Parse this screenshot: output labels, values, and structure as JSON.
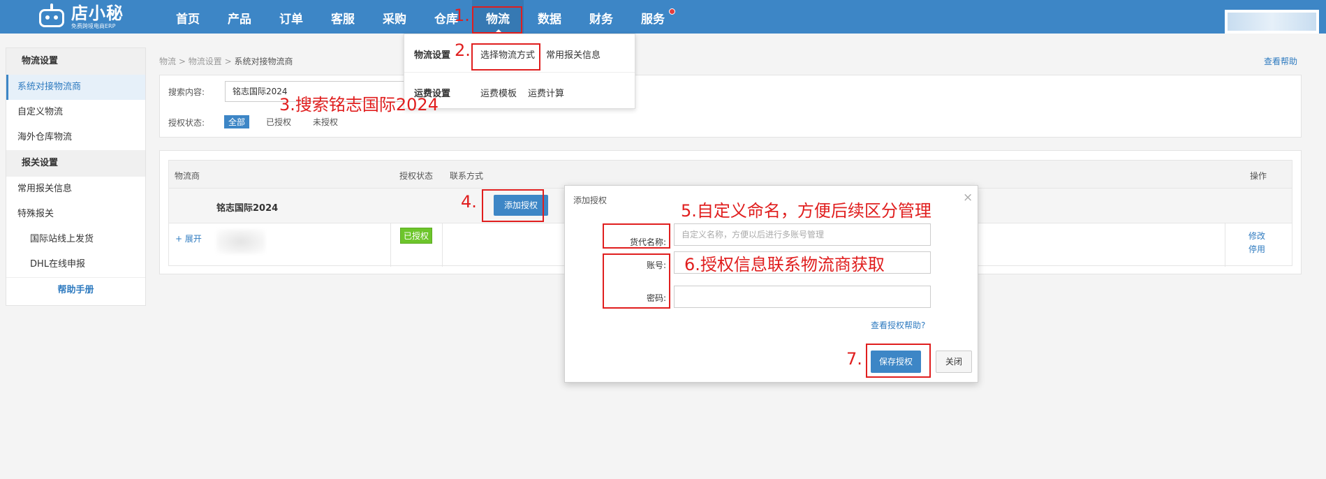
{
  "app": {
    "logo_name": "店小秘",
    "logo_sub": "免费跨境电商ERP"
  },
  "nav": [
    "首页",
    "产品",
    "订单",
    "客服",
    "采购",
    "仓库",
    "物流",
    "数据",
    "财务",
    "服务"
  ],
  "dropdown": {
    "group1_title": "物流设置",
    "group1_links": [
      "选择物流方式",
      "常用报关信息"
    ],
    "group2_title": "运费设置",
    "group2_links": [
      "运费模板",
      "运费计算"
    ]
  },
  "sidebar": {
    "section1": "物流设置",
    "items1": [
      "系统对接物流商",
      "自定义物流",
      "海外仓库物流"
    ],
    "section2": "报关设置",
    "items2": [
      "常用报关信息",
      "特殊报关"
    ],
    "sub_items": [
      "国际站线上发货",
      "DHL在线申报"
    ],
    "help": "帮助手册"
  },
  "breadcrumb": {
    "part1": "物流",
    "part2": "物流设置",
    "current": "系统对接物流商",
    "sep": ">"
  },
  "help_link": "查看帮助",
  "search": {
    "label": "搜索内容:",
    "value": "铭志国际2024",
    "status_label": "授权状态:",
    "chips": [
      "全部",
      "已授权",
      "未授权"
    ]
  },
  "table": {
    "headers": [
      "物流商",
      "授权状态",
      "联系方式",
      "操作"
    ],
    "group_name": "铭志国际2024",
    "add_auth": "添加授权",
    "expand": "+ 展开",
    "status": "已授权",
    "ops": [
      "修改",
      "停用"
    ]
  },
  "modal": {
    "title": "添加授权",
    "close": "×",
    "field1_label": "货代名称:",
    "field1_placeholder": "自定义名称，方便以后进行多账号管理",
    "field2_label": "账号:",
    "field3_label": "密码:",
    "help": "查看授权帮助?",
    "save": "保存授权",
    "cancel": "关闭"
  },
  "annotations": {
    "step1": "1.",
    "step2": "2.",
    "step3": "3.搜索铭志国际2024",
    "step4": "4.",
    "step5": "5.自定义命名，方便后续区分管理",
    "step6": "6.授权信息联系物流商获取",
    "step7": "7."
  },
  "colors": {
    "primary": "#3d86c6",
    "annotation": "#e01e1e",
    "success": "#6dc52b",
    "link": "#2f7bc0"
  }
}
